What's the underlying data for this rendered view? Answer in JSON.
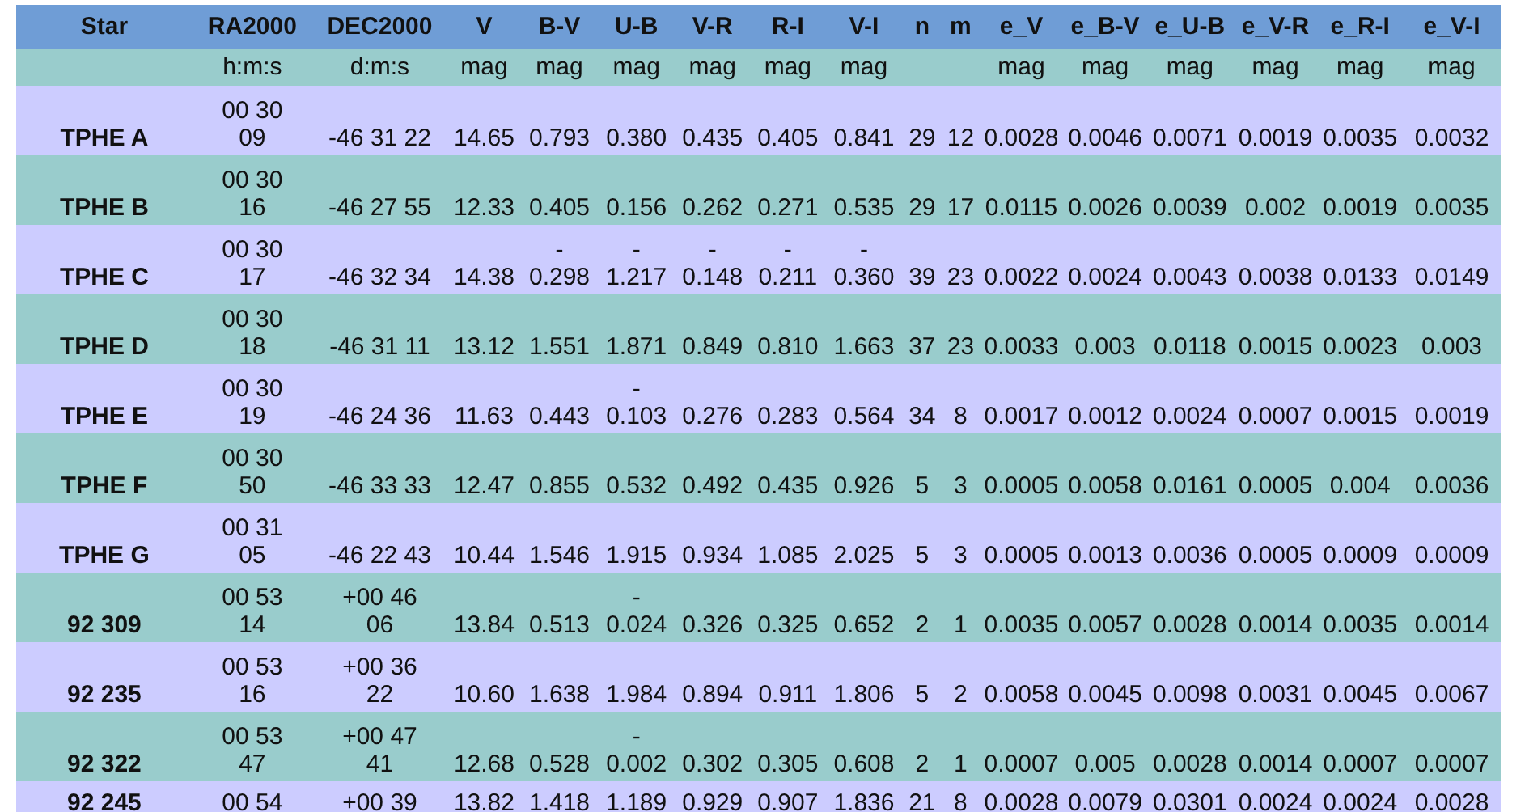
{
  "table": {
    "columns": [
      {
        "label": "Star"
      },
      {
        "label": "RA2000",
        "unit": "h:m:s"
      },
      {
        "label": "DEC2000",
        "unit": "d:m:s"
      },
      {
        "label": "V",
        "unit": "mag"
      },
      {
        "label": "B-V",
        "unit": "mag"
      },
      {
        "label": "U-B",
        "unit": "mag"
      },
      {
        "label": "V-R",
        "unit": "mag"
      },
      {
        "label": "R-I",
        "unit": "mag"
      },
      {
        "label": "V-I",
        "unit": "mag"
      },
      {
        "label": "n"
      },
      {
        "label": "m"
      },
      {
        "label": "e_V",
        "unit": "mag"
      },
      {
        "label": "e_B-V",
        "unit": "mag"
      },
      {
        "label": "e_U-B",
        "unit": "mag"
      },
      {
        "label": "e_V-R",
        "unit": "mag"
      },
      {
        "label": "e_R-I",
        "unit": "mag"
      },
      {
        "label": "e_V-I",
        "unit": "mag"
      }
    ],
    "rows": [
      [
        "TPHE A",
        "00 30\n09",
        "-46 31 22",
        "14.65",
        "0.793",
        "0.380",
        "0.435",
        "0.405",
        "0.841",
        "29",
        "12",
        "0.0028",
        "0.0046",
        "0.0071",
        "0.0019",
        "0.0035",
        "0.0032"
      ],
      [
        "TPHE B",
        "00 30\n16",
        "-46 27 55",
        "12.33",
        "0.405",
        "0.156",
        "0.262",
        "0.271",
        "0.535",
        "29",
        "17",
        "0.0115",
        "0.0026",
        "0.0039",
        "0.002",
        "0.0019",
        "0.0035"
      ],
      [
        "TPHE C",
        "00 30\n17",
        "-46 32 34",
        "14.38",
        "-\n0.298",
        "-\n1.217",
        "-\n0.148",
        "-\n0.211",
        "-\n0.360",
        "39",
        "23",
        "0.0022",
        "0.0024",
        "0.0043",
        "0.0038",
        "0.0133",
        "0.0149"
      ],
      [
        "TPHE D",
        "00 30\n18",
        "-46 31 11",
        "13.12",
        "1.551",
        "1.871",
        "0.849",
        "0.810",
        "1.663",
        "37",
        "23",
        "0.0033",
        "0.003",
        "0.0118",
        "0.0015",
        "0.0023",
        "0.003"
      ],
      [
        "TPHE E",
        "00 30\n19",
        "-46 24 36",
        "11.63",
        "0.443",
        "-\n0.103",
        "0.276",
        "0.283",
        "0.564",
        "34",
        "8",
        "0.0017",
        "0.0012",
        "0.0024",
        "0.0007",
        "0.0015",
        "0.0019"
      ],
      [
        "TPHE F",
        "00 30\n50",
        "-46 33 33",
        "12.47",
        "0.855",
        "0.532",
        "0.492",
        "0.435",
        "0.926",
        "5",
        "3",
        "0.0005",
        "0.0058",
        "0.0161",
        "0.0005",
        "0.004",
        "0.0036"
      ],
      [
        "TPHE G",
        "00 31\n05",
        "-46 22 43",
        "10.44",
        "1.546",
        "1.915",
        "0.934",
        "1.085",
        "2.025",
        "5",
        "3",
        "0.0005",
        "0.0013",
        "0.0036",
        "0.0005",
        "0.0009",
        "0.0009"
      ],
      [
        "92 309",
        "00 53\n14",
        "+00 46\n06",
        "13.84",
        "0.513",
        "-\n0.024",
        "0.326",
        "0.325",
        "0.652",
        "2",
        "1",
        "0.0035",
        "0.0057",
        "0.0028",
        "0.0014",
        "0.0035",
        "0.0014"
      ],
      [
        "92 235",
        "00 53\n16",
        "+00 36\n22",
        "10.60",
        "1.638",
        "1.984",
        "0.894",
        "0.911",
        "1.806",
        "5",
        "2",
        "0.0058",
        "0.0045",
        "0.0098",
        "0.0031",
        "0.0045",
        "0.0067"
      ],
      [
        "92 322",
        "00 53\n47",
        "+00 47\n41",
        "12.68",
        "0.528",
        "-\n0.002",
        "0.302",
        "0.305",
        "0.608",
        "2",
        "1",
        "0.0007",
        "0.005",
        "0.0028",
        "0.0014",
        "0.0007",
        "0.0007"
      ],
      [
        "92 245",
        "00 54",
        "+00 39",
        "13.82",
        "1.418",
        "1.189",
        "0.929",
        "0.907",
        "1.836",
        "21",
        "8",
        "0.0028",
        "0.0079",
        "0.0301",
        "0.0024",
        "0.0024",
        "0.0028"
      ]
    ]
  }
}
